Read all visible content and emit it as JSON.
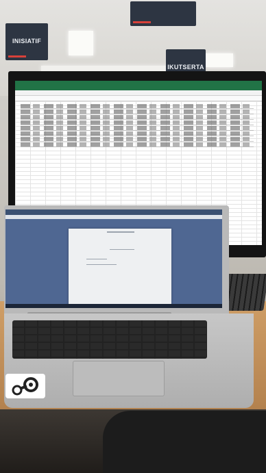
{
  "scene": {
    "signs": [
      {
        "label": "INISIATIF"
      },
      {
        "label": "IKUTSERTA"
      }
    ],
    "excel_title": "",
    "colors": {
      "excel_ribbon": "#217346",
      "laptop_screen": "#4f6792",
      "desk": "#c4915a"
    },
    "icons": [
      "steam-sticker-icon"
    ]
  }
}
